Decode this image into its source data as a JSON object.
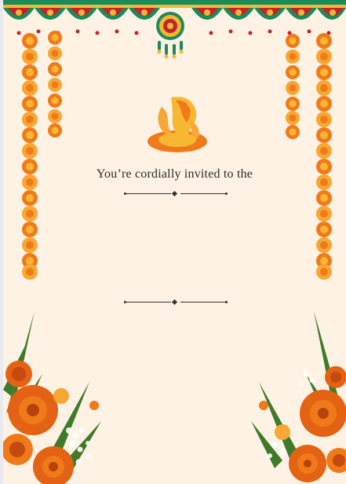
{
  "invitation": {
    "headline": "You’re cordially invited to the"
  },
  "colors": {
    "background": "#fdf2e3",
    "marigold_orange": "#f07a1a",
    "marigold_yellow": "#f7b733",
    "bunting_green": "#1d8a5b",
    "bunting_red": "#c0242d",
    "divider": "#333333"
  },
  "icons": [
    "ganesha-icon",
    "marigold-garland",
    "toran-bunting",
    "marigold-bouquet"
  ]
}
